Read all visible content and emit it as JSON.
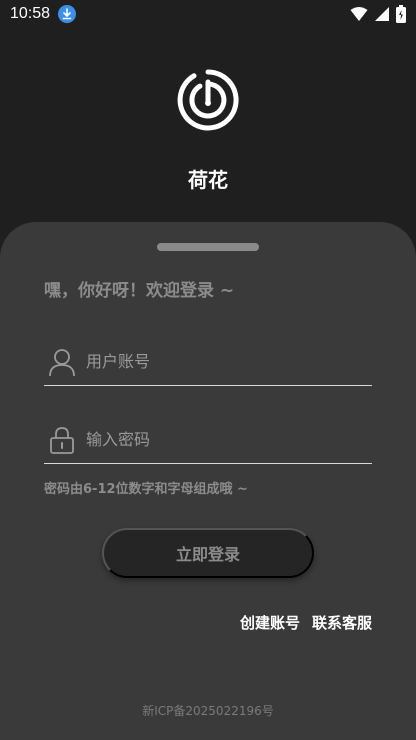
{
  "status_bar": {
    "time": "10:58"
  },
  "app": {
    "name": "荷花"
  },
  "login": {
    "greeting": "嘿，你好呀！欢迎登录 ~",
    "username_placeholder": "用户账号",
    "password_placeholder": "输入密码",
    "password_hint": "密码由6-12位数字和字母组成哦 ~",
    "login_button": "立即登录",
    "create_account": "创建账号",
    "contact_support": "联系客服"
  },
  "footer": {
    "icp": "新ICP备2025022196号"
  },
  "colors": {
    "background": "#1f1f1f",
    "sheet": "#3a3a3a",
    "muted_text": "#8c8c8c",
    "button": "#252525",
    "download_badge": "#3b8fe8"
  }
}
